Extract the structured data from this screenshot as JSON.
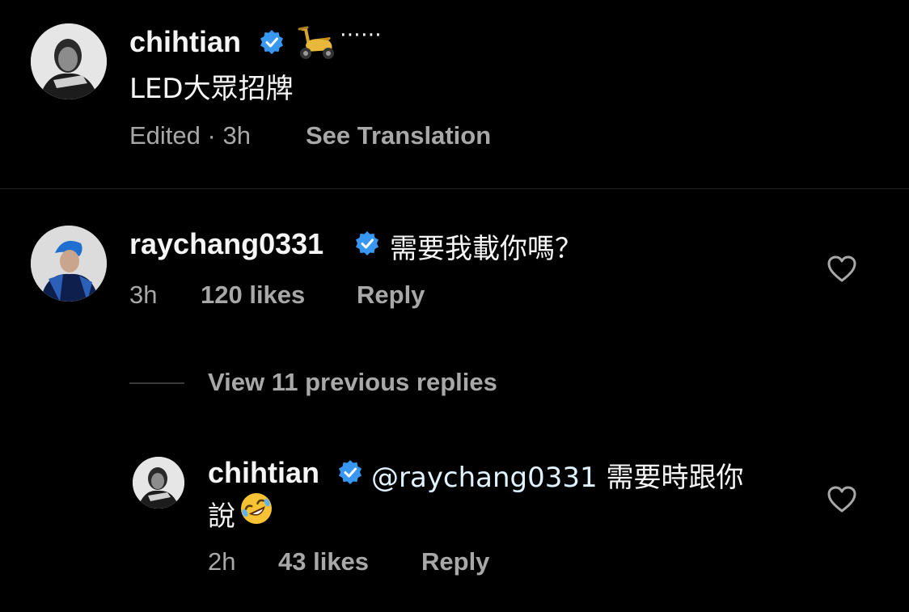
{
  "caption": {
    "username": "chihtian",
    "verified": true,
    "emoji_icon": "scooter-icon",
    "trailing_text": "⋯⋯",
    "text": "LED大眾招牌",
    "edited_label": "Edited · 3h",
    "see_translation": "See Translation"
  },
  "comment": {
    "username": "raychang0331",
    "verified": true,
    "text": "需要我載你嗎？",
    "time": "3h",
    "likes": "120 likes",
    "reply_label": "Reply",
    "like_icon": "heart-icon"
  },
  "view_replies": "View 11 previous replies",
  "reply": {
    "username": "chihtian",
    "verified": true,
    "mention": "@raychang0331",
    "text_line1": " 需要時跟你",
    "text_line2": "說",
    "emoji_icon": "rolling-on-floor-laughing-icon",
    "time": "2h",
    "likes": "43 likes",
    "reply_label": "Reply",
    "like_icon": "heart-icon"
  },
  "colors": {
    "background": "#000000",
    "primary_text": "#f5f5f5",
    "secondary_text": "#a8a8a8",
    "verified_blue": "#3897f0",
    "mention": "#e0f1ff"
  }
}
